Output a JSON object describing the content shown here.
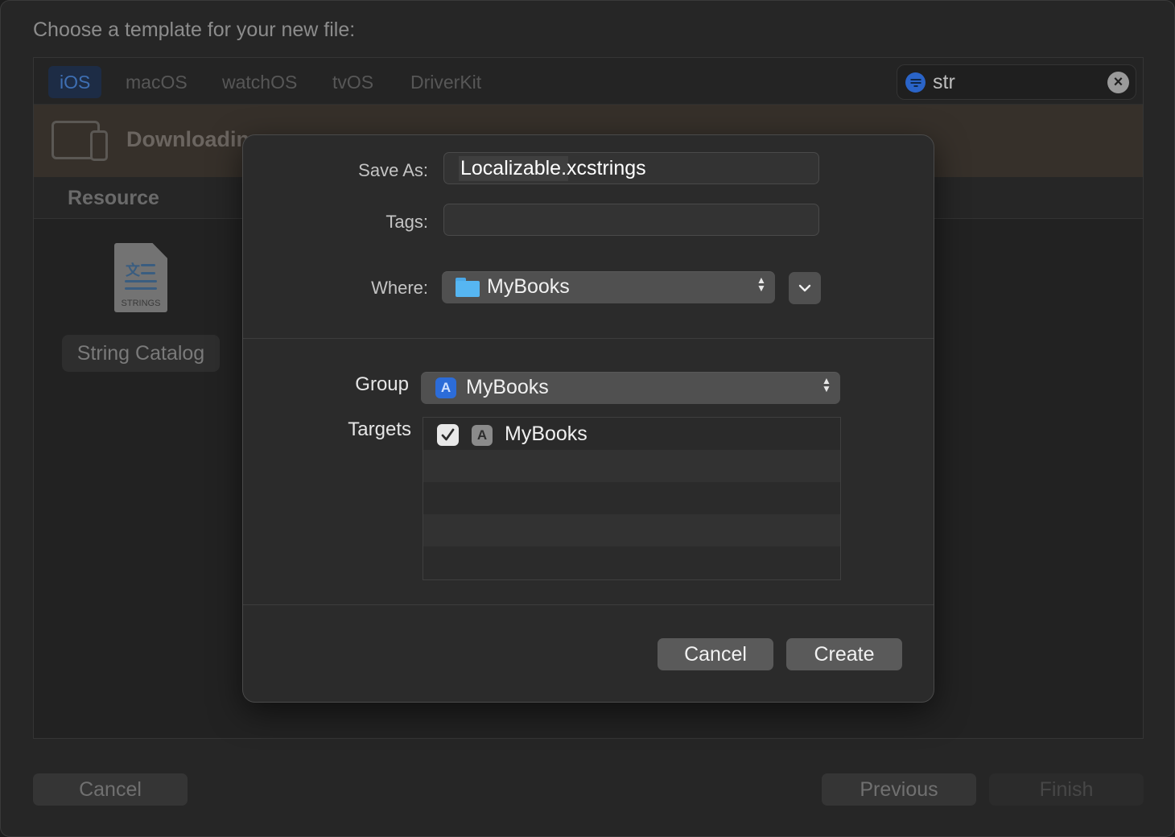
{
  "window": {
    "title": "Choose a template for your new file:"
  },
  "platform_tabs": [
    {
      "label": "iOS",
      "active": true
    },
    {
      "label": "macOS",
      "active": false
    },
    {
      "label": "watchOS",
      "active": false
    },
    {
      "label": "tvOS",
      "active": false
    },
    {
      "label": "DriverKit",
      "active": false
    }
  ],
  "search": {
    "value": "str",
    "filter_icon": "filter-icon",
    "clear_icon": "clear-icon"
  },
  "banner": {
    "text": "Downloadin",
    "icon": "device-icon"
  },
  "section": {
    "header": "Resource"
  },
  "template_item": {
    "icon_caption": "STRINGS",
    "label": "String Catalog"
  },
  "dialog": {
    "save_as_label": "Save As:",
    "save_as_value": "Localizable.xcstrings",
    "tags_label": "Tags:",
    "tags_value": "",
    "where_label": "Where:",
    "where_value": "MyBooks",
    "group_label": "Group",
    "group_value": "MyBooks",
    "targets_label": "Targets",
    "targets": [
      {
        "name": "MyBooks",
        "checked": true
      }
    ],
    "cancel_label": "Cancel",
    "create_label": "Create"
  },
  "footer": {
    "cancel_label": "Cancel",
    "previous_label": "Previous",
    "finish_label": "Finish"
  },
  "colors": {
    "accent": "#2c6cd8",
    "active_tab_bg": "#1d2c45",
    "banner_bg": "#36302a",
    "sheet_bg": "#2b2b2b"
  }
}
